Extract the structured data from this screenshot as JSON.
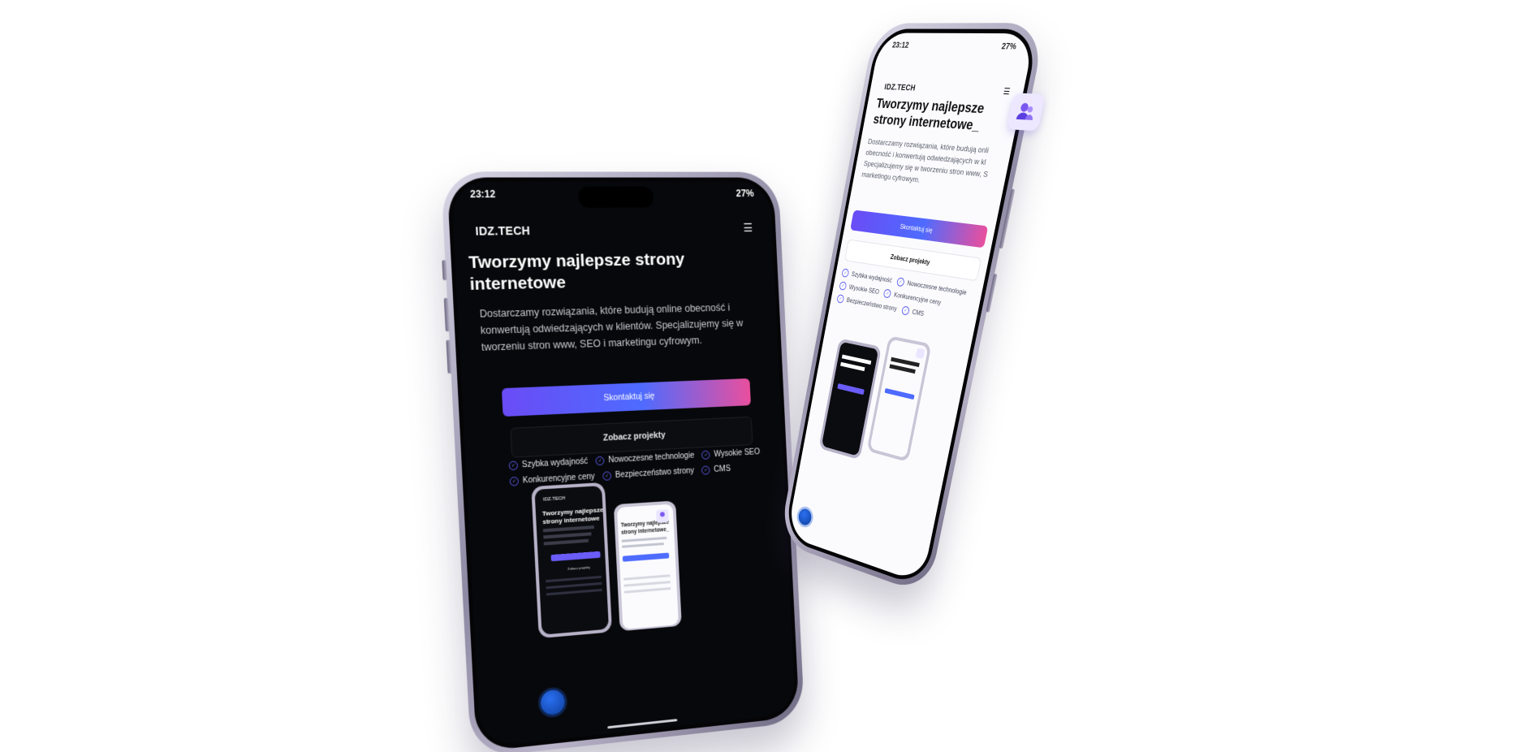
{
  "dark_phone": {
    "status_time": "23:12",
    "status_battery": "27%",
    "brand": "IDZ.TECH",
    "menu_icon": "hamburger-icon",
    "title": "Tworzymy najlepsze strony internetowe",
    "description": "Dostarczamy rozwiązania, które budują online obecność i konwertują odwiedzających w klientów. Specjalizujemy się w tworzeniu stron www, SEO i marketingu cyfrowym.",
    "cta_primary": "Skontaktuj się",
    "cta_secondary": "Zobacz projekty",
    "features": [
      "Szybka wydajność",
      "Nowoczesne technologie",
      "Wysokie SEO",
      "Konkurencyjne ceny",
      "Bezpieczeństwo strony",
      "CMS"
    ],
    "mini_brand": "IDZ.TECH",
    "mini_title": "Tworzymy najlepsze strony internetowe",
    "mini_light_title": "Tworzymy najlepsze strony internetowe_",
    "mini_cta": "Zobacz projekty"
  },
  "light_phone": {
    "status_time": "23:12",
    "status_battery": "27%",
    "brand": "IDZ.TECH",
    "title": "Tworzymy najlepsze strony internetowe_",
    "description": "Dostarczamy rozwiązania, które budują onli obecność i konwertują odwiedzających w kl Specjalizujemy się w tworzeniu stron www, S marketingu cyfrowym.",
    "cta_primary": "Skontaktuj się",
    "cta_secondary": "Zobacz projekty",
    "features": [
      "Szybka wydajność",
      "Nowoczesne technologie",
      "Wysokie SEO",
      "Konkurencyjne ceny",
      "Bezpieczeństwo strony",
      "CMS"
    ],
    "badge_icon": "users-icon"
  },
  "colors": {
    "accent_start": "#6a4cf5",
    "accent_mid": "#4e6bff",
    "accent_end": "#e94f9d",
    "frame": "#b9b4c9"
  }
}
